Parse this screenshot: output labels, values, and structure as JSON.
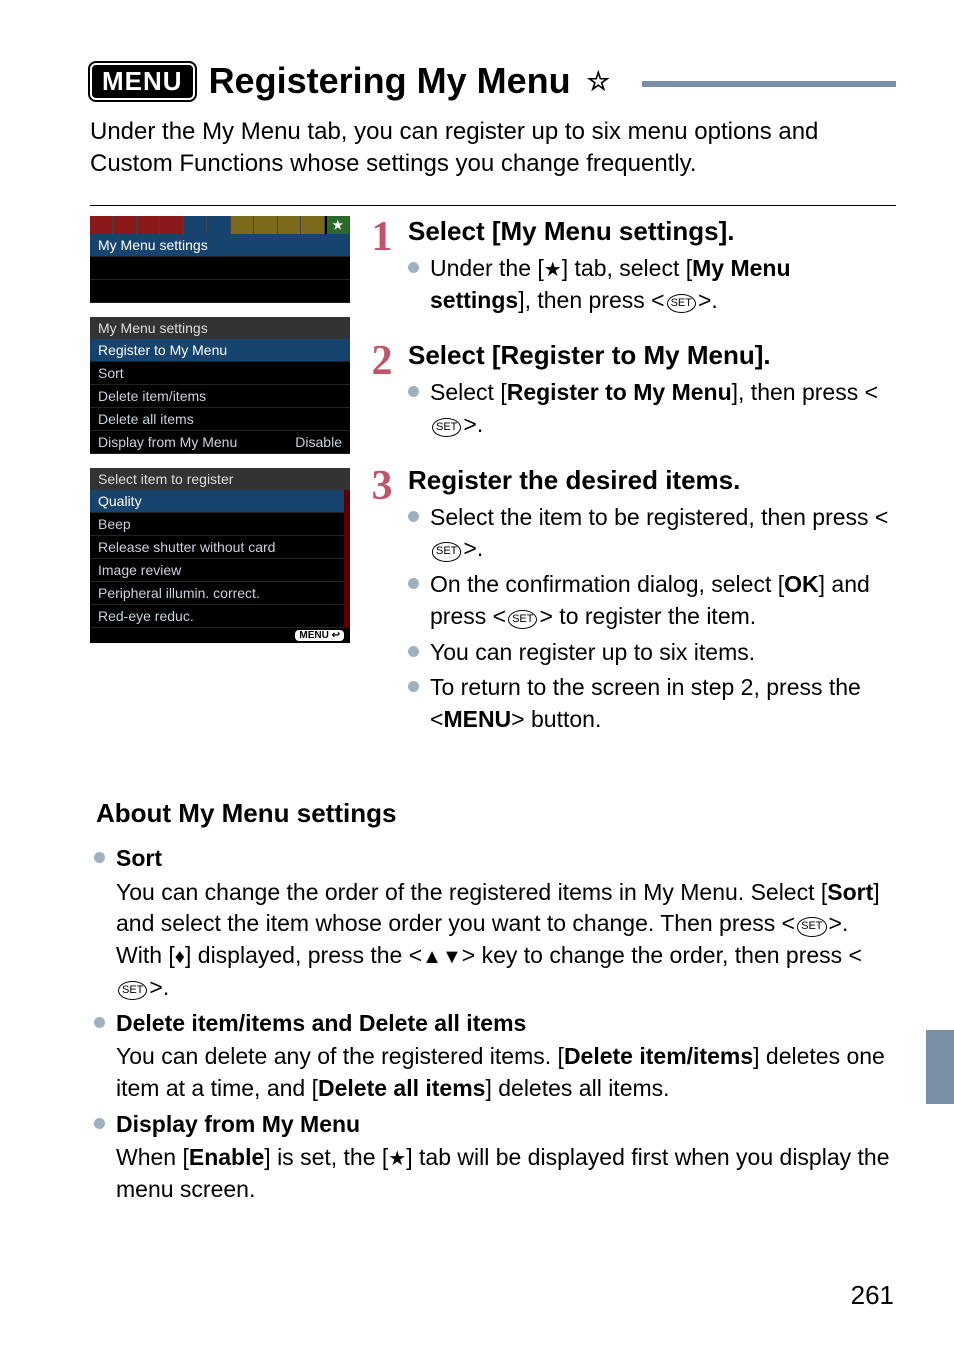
{
  "header": {
    "menu_badge": "MENU",
    "title": "Registering My Menu",
    "star": "☆"
  },
  "intro": "Under the My Menu tab, you can register up to six menu options and Custom Functions whose settings you change frequently.",
  "shots": {
    "s1": {
      "row1": "My Menu settings"
    },
    "s2": {
      "hdr": "My Menu settings",
      "r1": "Register to My Menu",
      "r2": "Sort",
      "r3": "Delete item/items",
      "r4": "Delete all items",
      "r5a": "Display from My Menu",
      "r5b": "Disable"
    },
    "s3": {
      "hdr": "Select item to register",
      "r1": "Quality",
      "r2": "Beep",
      "r3": "Release shutter without card",
      "r4": "Image review",
      "r5": "Peripheral illumin. correct.",
      "r6": "Red-eye reduc.",
      "foot": "MENU ↩"
    }
  },
  "steps": {
    "s1": {
      "num": "1",
      "title": "Select [My Menu settings].",
      "b1a": "Under the [",
      "b1b": "] tab, select [",
      "b1c": "My Menu settings",
      "b1d": "], then press <",
      "b1e": ">."
    },
    "s2": {
      "num": "2",
      "title": "Select [Register to My Menu].",
      "b1a": "Select [",
      "b1b": "Register to My Menu",
      "b1c": "], then press <",
      "b1d": ">."
    },
    "s3": {
      "num": "3",
      "title": "Register the desired items.",
      "b1a": "Select the item to be registered, then press <",
      "b1b": ">.",
      "b2a": "On the confirmation dialog, select [",
      "b2b": "OK",
      "b2c": "] and press <",
      "b2d": "> to register the item.",
      "b3": "You can register up to six items.",
      "b4a": "To return to the screen in step 2, press the <",
      "b4b": "> button."
    }
  },
  "section_title": "About My Menu settings",
  "about": {
    "sort": {
      "hd": "Sort",
      "t1": "You can change the order of the registered items in My Menu. Select [",
      "t2": "Sort",
      "t3": "] and select the item whose order you want to change. Then press <",
      "t4": ">. With [",
      "t5": "] displayed, press the <",
      "t6": "> key to change the order, then press <",
      "t7": ">."
    },
    "del": {
      "hd": "Delete item/items and Delete all items",
      "t1": "You can delete any of the registered items. [",
      "t2": "Delete item/items",
      "t3": "] deletes one item at a time, and [",
      "t4": "Delete all items",
      "t5": "] deletes all items."
    },
    "disp": {
      "hd": "Display from My Menu",
      "t1": "When [",
      "t2": "Enable",
      "t3": "] is set, the [",
      "t4": "] tab will be displayed first when you display the menu screen."
    }
  },
  "glyphs": {
    "set": "SET",
    "menu": "MENU",
    "star": "★",
    "updown": "♦",
    "updownkey": "▲▼"
  },
  "page_number": "261"
}
